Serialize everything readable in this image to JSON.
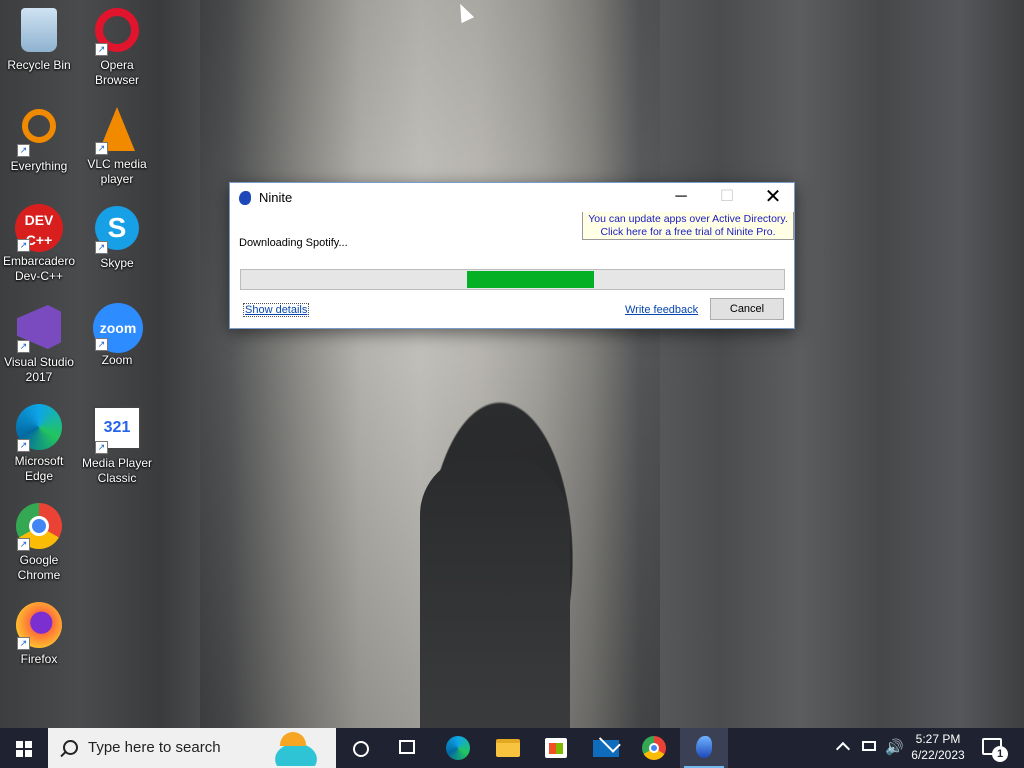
{
  "desktop": {
    "icons": [
      {
        "label": "Recycle Bin",
        "icon": "recycle-bin-icon"
      },
      {
        "label": "Opera Browser",
        "icon": "opera-icon"
      },
      {
        "label": "Everything",
        "icon": "everything-search-icon"
      },
      {
        "label": "VLC media player",
        "icon": "vlc-icon"
      },
      {
        "label": "Embarcadero Dev-C++",
        "icon": "devcpp-icon",
        "icon_text": "DEV\nC++"
      },
      {
        "label": "Skype",
        "icon": "skype-icon",
        "icon_text": "S"
      },
      {
        "label": "Visual Studio 2017",
        "icon": "visual-studio-icon"
      },
      {
        "label": "Zoom",
        "icon": "zoom-icon",
        "icon_text": "zoom"
      },
      {
        "label": "Microsoft Edge",
        "icon": "edge-icon"
      },
      {
        "label": "Media Player Classic",
        "icon": "mpc-icon",
        "icon_text": "321"
      },
      {
        "label": "Google Chrome",
        "icon": "chrome-icon"
      },
      {
        "label": "Firefox",
        "icon": "firefox-icon"
      }
    ]
  },
  "ninite": {
    "title": "Ninite",
    "minimize_glyph": "─",
    "maximize_glyph": "☐",
    "close_glyph": "✕",
    "pro_banner_line1": "You can update apps over Active Directory.",
    "pro_banner_line2": "Click here for a free trial of Ninite Pro.",
    "status": "Downloading Spotify...",
    "progress_color": "#06b025",
    "show_details": "Show details",
    "write_feedback": "Write feedback",
    "cancel": "Cancel"
  },
  "taskbar": {
    "search_placeholder": "Type here to search",
    "pinned": [
      "cortana",
      "task-view",
      "edge",
      "file-explorer",
      "microsoft-store",
      "mail",
      "chrome",
      "ninite"
    ],
    "active_app": "ninite",
    "volume_glyph": "🔊",
    "clock_time": "5:27 PM",
    "clock_date": "6/22/2023",
    "notification_count": "1"
  }
}
